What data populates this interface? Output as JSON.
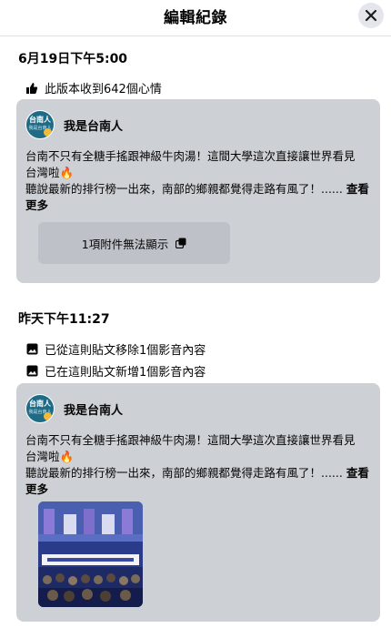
{
  "header": {
    "title": "編輯紀錄",
    "close_icon": "close-icon"
  },
  "revisions": [
    {
      "timestamp": "6月19日下午5:00",
      "changes": [
        {
          "icon": "thumbs-up-icon",
          "text": "此版本收到642個心情"
        }
      ],
      "post": {
        "author": "我是台南人",
        "avatar_text": "台南人",
        "avatar_sub": "我是台南人",
        "line1": "台南不只有全糖手搖跟神級牛肉湯！這間大學這次直接讓世界看見",
        "line2": "台灣啦🔥",
        "line3": "聽說最新的排行榜一出來，南部的鄉親都覺得走路有風了！......",
        "see_more": "查看更多",
        "attachment": "1項附件無法顯示"
      }
    },
    {
      "timestamp": "昨天下午11:27",
      "changes": [
        {
          "icon": "photo-icon",
          "text": "已從這則貼文移除1個影音內容"
        },
        {
          "icon": "photo-icon",
          "text": "已在這則貼文新增1個影音內容"
        }
      ],
      "post": {
        "author": "我是台南人",
        "avatar_text": "台南人",
        "avatar_sub": "我是台南人",
        "line1": "台南不只有全糖手搖跟神級牛肉湯！這間大學這次直接讓世界看見",
        "line2": "台灣啦🔥",
        "line3": "聽說最新的排行榜一出來，南部的鄉親都覺得走路有風了！......",
        "see_more": "查看更多"
      }
    }
  ],
  "colors": {
    "card_bg": "#cdd0d5",
    "attachment_bg": "#bec2c8",
    "avatar_bg": "#1f6b86"
  }
}
